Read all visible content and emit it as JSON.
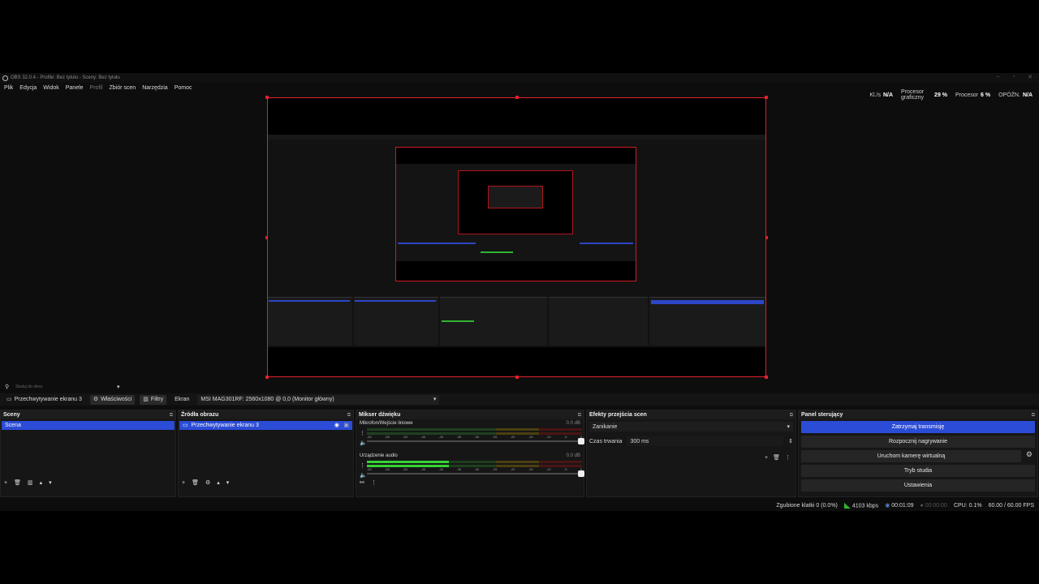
{
  "window": {
    "title": "OBS 32.0.4 - Profile: Bez tytułu - Sceny: Bez tytułu"
  },
  "menu": [
    "Plik",
    "Edycja",
    "Widok",
    "Panele",
    "Profil",
    "Zbiór scen",
    "Narzędzia",
    "Pomoc"
  ],
  "stats": {
    "kbps_label": "Kl./s",
    "kbps_value": "N/A",
    "gpu_label_1": "Procesor",
    "gpu_label_2": "graficzny",
    "gpu_value": "29 %",
    "cpu_label": "Procesor",
    "cpu_value": "6 %",
    "delay_label": "OPÓŹN.",
    "delay_value": "N/A"
  },
  "transition_bar": {
    "label": "Skaluj do okna"
  },
  "source_toolbar": {
    "source_name": "Przechwytywanie ekranu 3",
    "properties": "Właściwości",
    "filters": "Filtry",
    "screen_label": "Ekran",
    "screen_value": "MSI MAG301RF: 2560x1080 @ 0,0 (Monitor główny)"
  },
  "scenes": {
    "title": "Sceny",
    "items": [
      "Scena"
    ]
  },
  "sources": {
    "title": "Źródła obrazu",
    "items": [
      "Przechwytywanie ekranu 3"
    ]
  },
  "mixer": {
    "title": "Mikser dźwięku",
    "channels": [
      {
        "name": "Mikrofon/Wejście liniowe",
        "db": "0.0 dB",
        "level": 0.0
      },
      {
        "name": "Urządzenie audio",
        "db": "0.0 dB",
        "level": 0.38
      }
    ],
    "scale": [
      "-60",
      "-55",
      "-50",
      "-45",
      "-40",
      "-35",
      "-30",
      "-25",
      "-20",
      "-15",
      "-10",
      "-5",
      "0"
    ]
  },
  "transitions": {
    "title": "Efekty przejścia scen",
    "selected": "Zanikanie",
    "duration_label": "Czas trwania",
    "duration_value": "300 ms"
  },
  "controls": {
    "title": "Panel sterujący",
    "stop_stream": "Zatrzymaj transmisję",
    "start_record": "Rozpocznij nagrywanie",
    "virtual_cam": "Uruchom kamerę wirtualną",
    "studio_mode": "Tryb studia",
    "settings": "Ustawienia"
  },
  "status": {
    "dropped": "Zgubione klatki 0 (0.0%)",
    "bitrate": "4103 kbps",
    "stream_time": "00:01:09",
    "rec_time": "00:00:00",
    "cpu": "CPU: 0.1%",
    "fps": "60.00 / 60.00 FPS"
  },
  "colors": {
    "accent": "#2b4cd6",
    "selection_border": "#e0202c",
    "meter_green": "#36d336"
  }
}
